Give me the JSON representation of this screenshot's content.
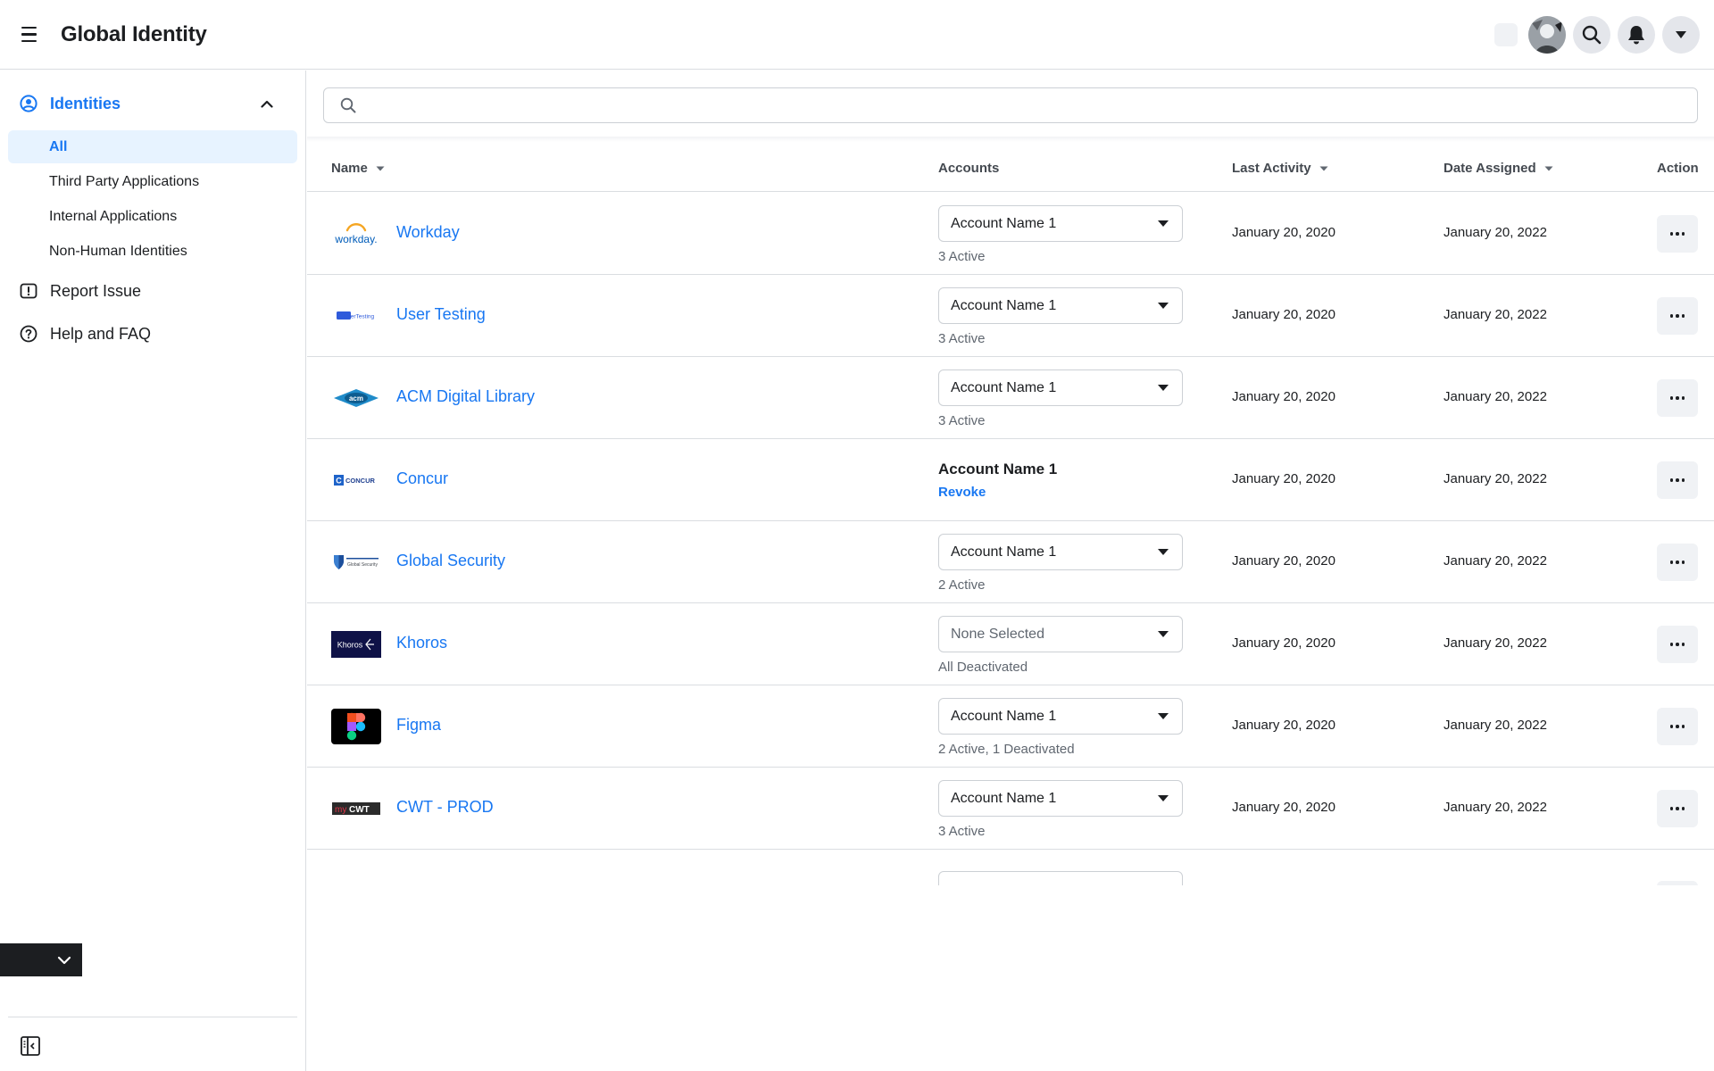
{
  "app": {
    "title": "Global Identity"
  },
  "sidebar": {
    "section_label": "Identities",
    "items": [
      {
        "label": "All",
        "active": true
      },
      {
        "label": "Third Party Applications",
        "active": false
      },
      {
        "label": "Internal Applications",
        "active": false
      },
      {
        "label": "Non-Human Identities",
        "active": false
      }
    ],
    "links": [
      {
        "label": "Report Issue",
        "icon": "report-issue-icon"
      },
      {
        "label": "Help and FAQ",
        "icon": "help-icon"
      }
    ]
  },
  "search": {
    "placeholder": ""
  },
  "table": {
    "columns": {
      "name": "Name",
      "accounts": "Accounts",
      "last_activity": "Last Activity",
      "date_assigned": "Date Assigned",
      "action": "Action"
    },
    "rows": [
      {
        "name": "Workday",
        "logo": "workday-logo",
        "account": "Account Name 1",
        "account_mode": "select",
        "status": "3 Active",
        "last_activity": "January 20, 2020",
        "date_assigned": "January 20, 2022"
      },
      {
        "name": "User Testing",
        "logo": "usertesting-logo",
        "account": "Account Name 1",
        "account_mode": "select",
        "status": "3 Active",
        "last_activity": "January 20, 2020",
        "date_assigned": "January 20, 2022"
      },
      {
        "name": "ACM Digital Library",
        "logo": "acm-logo",
        "account": "Account Name 1",
        "account_mode": "select",
        "status": "3 Active",
        "last_activity": "January 20, 2020",
        "date_assigned": "January 20, 2022"
      },
      {
        "name": "Concur",
        "logo": "concur-logo",
        "account": "Account Name 1",
        "account_mode": "plain",
        "status": "Revoke",
        "last_activity": "January 20, 2020",
        "date_assigned": "January 20, 2022"
      },
      {
        "name": "Global Security",
        "logo": "global-security-logo",
        "account": "Account Name 1",
        "account_mode": "select",
        "status": "2 Active",
        "last_activity": "January 20, 2020",
        "date_assigned": "January 20, 2022"
      },
      {
        "name": "Khoros",
        "logo": "khoros-logo",
        "account": "None Selected",
        "account_mode": "placeholder",
        "status": "All Deactivated",
        "last_activity": "January 20, 2020",
        "date_assigned": "January 20, 2022"
      },
      {
        "name": "Figma",
        "logo": "figma-logo",
        "account": "Account Name 1",
        "account_mode": "select",
        "status": "2 Active, 1 Deactivated",
        "last_activity": "January 20, 2020",
        "date_assigned": "January 20, 2022"
      },
      {
        "name": "CWT - PROD",
        "logo": "mycwt-logo",
        "account": "Account Name 1",
        "account_mode": "select",
        "status": "3 Active",
        "last_activity": "January 20, 2020",
        "date_assigned": "January 20, 2022"
      }
    ]
  },
  "logo_text": {
    "workday": "workday.",
    "usertesting": "UserTesting",
    "acm": "acm",
    "concur": "CONCUR",
    "global_security": "Global Security",
    "khoros": "Khoros",
    "mycwt_my": "my",
    "mycwt_cwt": "CWT"
  },
  "colors": {
    "accent": "#1877f2",
    "active_bg": "#e7f3ff",
    "border": "#dadde1",
    "muted_text": "#606770"
  }
}
